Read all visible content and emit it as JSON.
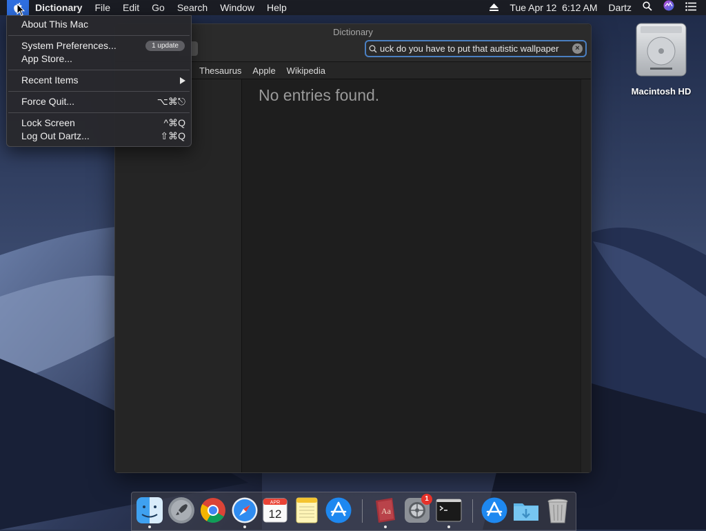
{
  "menubar": {
    "app_name": "Dictionary",
    "menus": [
      "File",
      "Edit",
      "Go",
      "Search",
      "Window",
      "Help"
    ],
    "datetime": "Tue Apr 12  6:12 AM",
    "user": "Dartz"
  },
  "apple_menu": {
    "about": "About This Mac",
    "system_prefs": "System Preferences...",
    "system_prefs_badge": "1 update",
    "app_store": "App Store...",
    "recent_items": "Recent Items",
    "force_quit": "Force Quit...",
    "force_quit_shortcut": "⌥⌘⎋",
    "lock_screen": "Lock Screen",
    "lock_screen_shortcut": "^⌘Q",
    "log_out": "Log Out Dartz...",
    "log_out_shortcut": "⇧⌘Q"
  },
  "dictionary_window": {
    "title": "Dictionary",
    "search_value": "uck do you have to put that autistic wallpaper",
    "scopes": [
      "Thesaurus",
      "Apple",
      "Wikipedia"
    ],
    "no_entries": "No entries found."
  },
  "desktop": {
    "drive_label": "Macintosh HD"
  },
  "dock": {
    "apps": [
      "finder",
      "launchpad",
      "chrome",
      "safari",
      "calendar",
      "notes",
      "app-store",
      "dictionary",
      "system-preferences",
      "terminal",
      "app-store-folder",
      "downloads",
      "trash"
    ],
    "calendar_month": "APR",
    "calendar_day": "12",
    "sysprefs_badge": "1",
    "dictionary_glyph": "Aa"
  },
  "colors": {
    "accent": "#2f6fe0",
    "menubar_bg": "#1b1d24",
    "window_bg": "#1f1f1f",
    "badge_red": "#e5322a"
  }
}
